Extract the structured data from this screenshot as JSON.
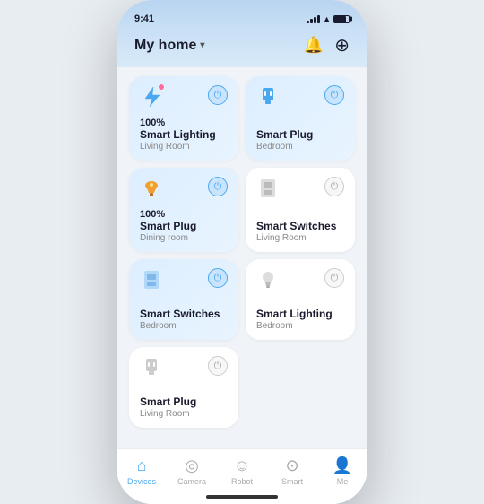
{
  "statusBar": {
    "time": "9:41",
    "signalBars": [
      3,
      5,
      7,
      9,
      11
    ],
    "batteryLevel": "80%"
  },
  "header": {
    "title": "My home",
    "chevron": "▾",
    "bellIcon": "🔔",
    "addIcon": "⊕"
  },
  "devices": [
    {
      "row": 0,
      "cards": [
        {
          "id": "smart-lighting-living",
          "icon": "⚡",
          "iconType": "lightning",
          "active": true,
          "hasDot": true,
          "percent": "100%",
          "label": "Smart Lighting",
          "sublabel": "Living Room",
          "powerState": "on"
        },
        {
          "id": "smart-plug-bedroom",
          "icon": "🔌",
          "iconType": "plug",
          "active": true,
          "hasDot": false,
          "percent": "",
          "label": "Smart Plug",
          "sublabel": "Bedroom",
          "powerState": "on"
        }
      ]
    },
    {
      "row": 1,
      "cards": [
        {
          "id": "smart-plug-dining",
          "icon": "💡",
          "iconType": "lamp",
          "active": true,
          "hasDot": false,
          "percent": "100%",
          "label": "Smart Plug",
          "sublabel": "Dining room",
          "powerState": "on"
        },
        {
          "id": "smart-switches-living",
          "icon": "🔲",
          "iconType": "switch",
          "active": false,
          "hasDot": false,
          "percent": "",
          "label": "Smart Switches",
          "sublabel": "Living Room",
          "powerState": "off"
        }
      ]
    },
    {
      "row": 2,
      "cards": [
        {
          "id": "smart-switches-bedroom",
          "icon": "🔲",
          "iconType": "switch-blue",
          "active": true,
          "hasDot": false,
          "percent": "",
          "label": "Smart Switches",
          "sublabel": "Bedroom",
          "powerState": "on"
        },
        {
          "id": "smart-lighting-bedroom",
          "icon": "💡",
          "iconType": "bulb",
          "active": false,
          "hasDot": false,
          "percent": "",
          "label": "Smart Lighting",
          "sublabel": "Bedroom",
          "powerState": "off"
        }
      ]
    },
    {
      "row": 3,
      "cards": [
        {
          "id": "smart-plug-living",
          "icon": "🔌",
          "iconType": "plug",
          "active": false,
          "hasDot": false,
          "percent": "",
          "label": "Smart Plug",
          "sublabel": "Living Room",
          "powerState": "off"
        }
      ]
    }
  ],
  "bottomNav": [
    {
      "id": "devices",
      "label": "Devices",
      "icon": "🏠",
      "active": true
    },
    {
      "id": "camera",
      "label": "Camera",
      "icon": "📷",
      "active": false
    },
    {
      "id": "robot",
      "label": "Robot",
      "icon": "😊",
      "active": false
    },
    {
      "id": "smart",
      "label": "Smart",
      "icon": "⊙",
      "active": false
    },
    {
      "id": "me",
      "label": "Me",
      "icon": "👤",
      "active": false
    }
  ]
}
